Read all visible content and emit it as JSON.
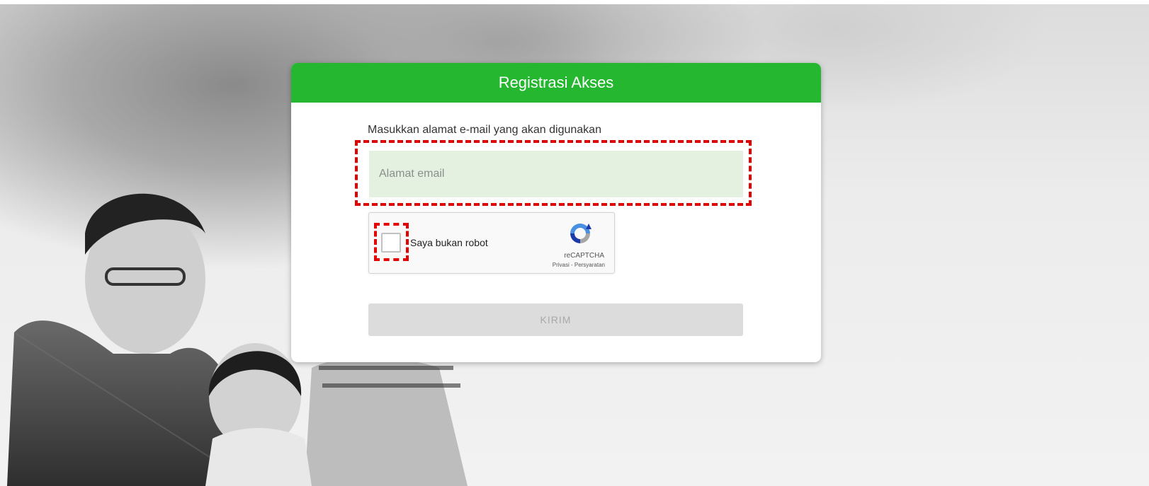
{
  "page": {
    "title": "Registrasi Akses",
    "accent_color": "#24b72f"
  },
  "form": {
    "instruction": "Masukkan alamat e-mail yang akan digunakan",
    "email_placeholder": "Alamat email",
    "email_value": "",
    "submit_label": "KIRIM",
    "submit_enabled": false
  },
  "recaptcha": {
    "label": "Saya bukan robot",
    "brand": "reCAPTCHA",
    "privacy_link": "Privasi",
    "separator": " - ",
    "terms_link": "Persyaratan",
    "checked": false
  },
  "annotations": {
    "highlight_color": "#e30000"
  },
  "icons": {
    "recaptcha_logo": "recaptcha-logo-icon"
  }
}
